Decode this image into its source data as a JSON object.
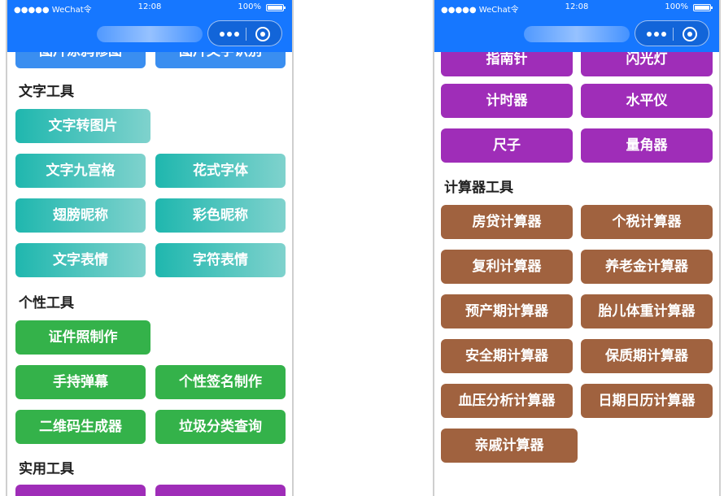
{
  "status_bar": {
    "carrier": "●●●●● WeChat令",
    "time": "12:08",
    "battery": "100%"
  },
  "left": {
    "top_cut_buttons": [
      "图片涂鸦修图",
      "图片文字识别"
    ],
    "sections": [
      {
        "title": "文字工具",
        "buttons": [
          "文字转图片",
          "文字九宫格",
          "花式字体",
          "翅膀昵称",
          "彩色昵称",
          "文字表情",
          "字符表情"
        ]
      },
      {
        "title": "个性工具",
        "buttons": [
          "证件照制作",
          "手持弹幕",
          "个性签名制作",
          "二维码生成器",
          "垃圾分类查询"
        ]
      },
      {
        "title": "实用工具",
        "buttons": [
          "",
          ""
        ]
      }
    ]
  },
  "right": {
    "top_cut_buttons": [
      "指南针",
      "闪光灯"
    ],
    "purple_buttons": [
      "计时器",
      "水平仪",
      "尺子",
      "量角器"
    ],
    "calc_section": {
      "title": "计算器工具",
      "buttons": [
        "房贷计算器",
        "个税计算器",
        "复利计算器",
        "养老金计算器",
        "预产期计算器",
        "胎儿体重计算器",
        "安全期计算器",
        "保质期计算器",
        "血压分析计算器",
        "日期日历计算器",
        "亲戚计算器"
      ]
    }
  },
  "colors": {
    "header": "#1677ff",
    "teal": "#1fb7ae",
    "green": "#34b24a",
    "purple": "#9f2db8",
    "brown": "#a0623f",
    "blue": "#3a8ef0"
  }
}
